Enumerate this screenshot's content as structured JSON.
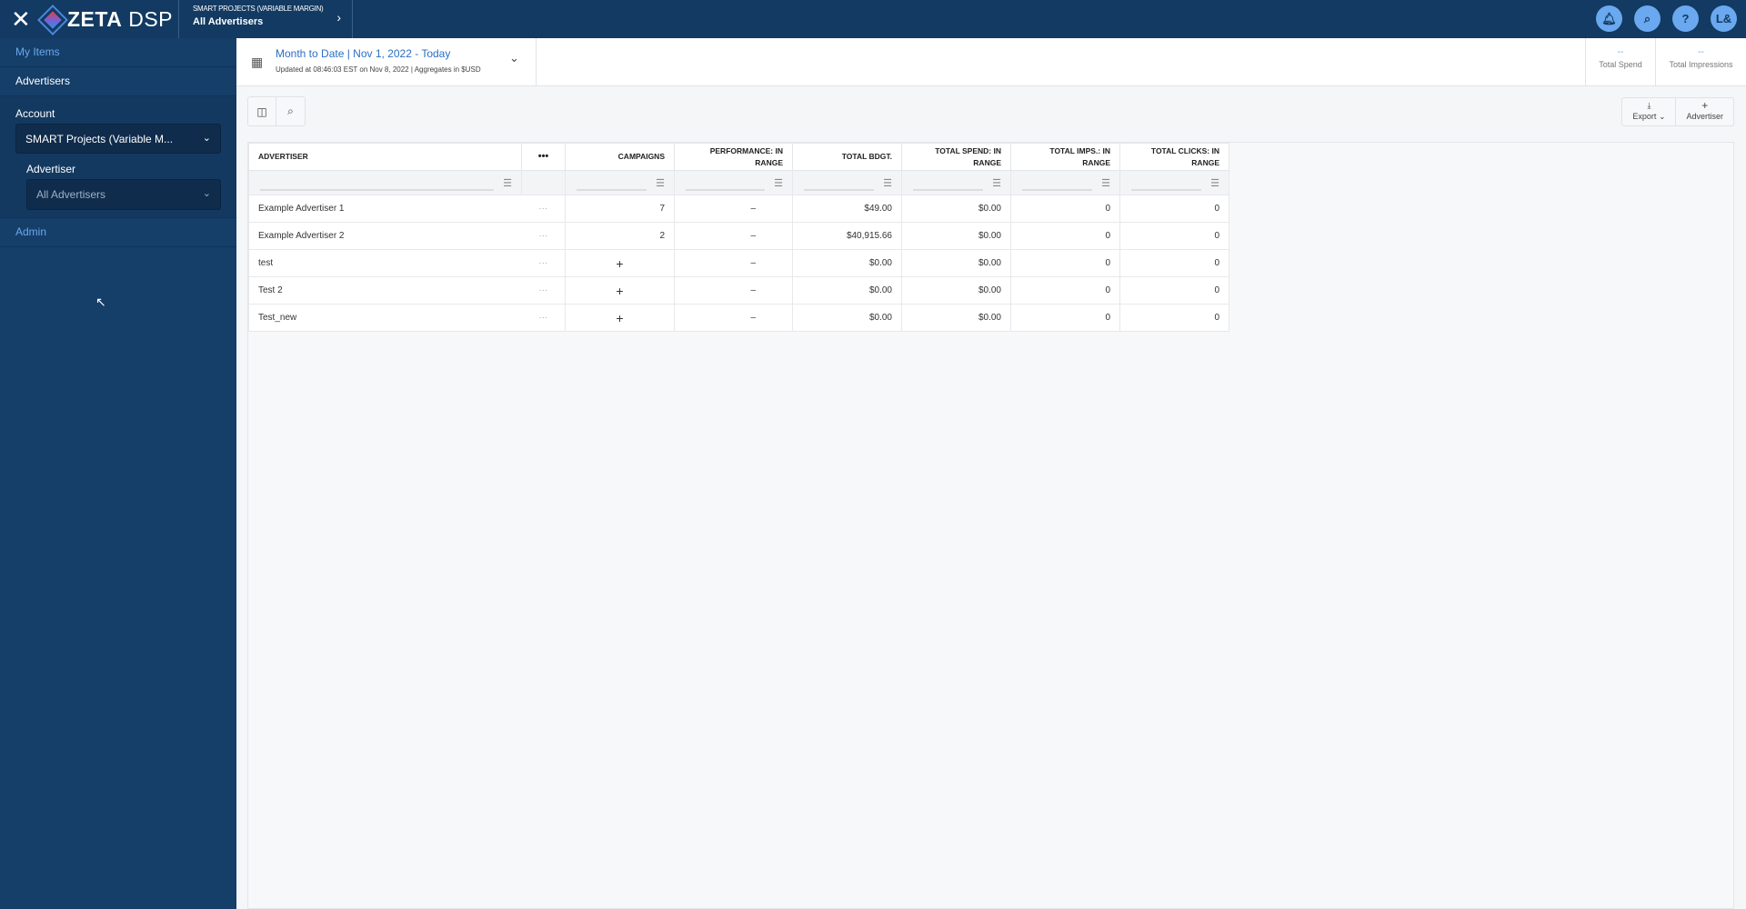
{
  "header": {
    "logo": "ZETA",
    "logo_suffix": "DSP",
    "breadcrumb_sub": "SMART PROJECTS (VARIABLE MARGIN)",
    "breadcrumb_main": "All Advertisers",
    "user_initials": "L&"
  },
  "sidebar": {
    "my_items": "My Items",
    "advertisers": "Advertisers",
    "account_label": "Account",
    "account_value": "SMART Projects (Variable M...",
    "advertiser_label": "Advertiser",
    "advertiser_value": "All Advertisers",
    "admin": "Admin"
  },
  "topbar": {
    "date_range": "Month to Date | Nov 1, 2022 - Today",
    "updated": "Updated at 08:46:03 EST on Nov 8, 2022 | Aggregates in $USD",
    "kpis": [
      {
        "value": "--",
        "label": "Total Spend"
      },
      {
        "value": "--",
        "label": "Total Impressions"
      }
    ]
  },
  "toolbar": {
    "export": "Export",
    "add_advertiser": "Advertiser"
  },
  "table": {
    "columns": [
      "ADVERTISER",
      "•••",
      "CAMPAIGNS",
      "PERFORMANCE: IN RANGE",
      "TOTAL BDGT.",
      "TOTAL SPEND: IN RANGE",
      "TOTAL IMPS.: IN RANGE",
      "TOTAL CLICKS: IN RANGE"
    ],
    "rows": [
      {
        "name": "Example Advertiser 1",
        "menu": "···",
        "campaigns": "7",
        "performance": "–",
        "budget": "$49.00",
        "spend": "$0.00",
        "imps": "0",
        "clicks": "0"
      },
      {
        "name": "Example Advertiser 2",
        "menu": "···",
        "campaigns": "2",
        "performance": "–",
        "budget": "$40,915.66",
        "spend": "$0.00",
        "imps": "0",
        "clicks": "0"
      },
      {
        "name": "test",
        "menu": "···",
        "campaigns": "+",
        "performance": "–",
        "budget": "$0.00",
        "spend": "$0.00",
        "imps": "0",
        "clicks": "0"
      },
      {
        "name": "Test 2",
        "menu": "···",
        "campaigns": "+",
        "performance": "–",
        "budget": "$0.00",
        "spend": "$0.00",
        "imps": "0",
        "clicks": "0"
      },
      {
        "name": "Test_new",
        "menu": "···",
        "campaigns": "+",
        "performance": "–",
        "budget": "$0.00",
        "spend": "$0.00",
        "imps": "0",
        "clicks": "0"
      }
    ]
  }
}
